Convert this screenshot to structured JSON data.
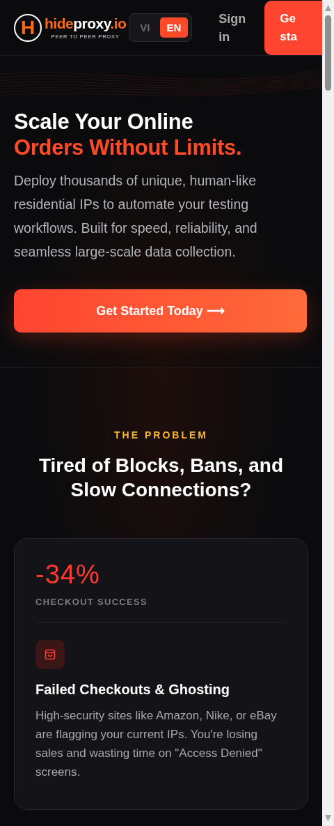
{
  "header": {
    "logo": {
      "mark": "H",
      "parts": [
        {
          "text": "hide",
          "kind": "accent"
        },
        {
          "text": "proxy",
          "kind": "plain"
        },
        {
          "text": ".io",
          "kind": "accent"
        }
      ],
      "tagline": "PEER TO PEER PROXY"
    },
    "languages": [
      {
        "label": "VI",
        "selected": false
      },
      {
        "label": "EN",
        "selected": true
      }
    ],
    "sign_in": "Sign in",
    "cta_lines": [
      "Ge",
      "sta"
    ]
  },
  "hero": {
    "title_lines": [
      {
        "text": "Scale Your Online",
        "kind": "plain"
      },
      {
        "text": "Orders Without Limits.",
        "kind": "accent"
      }
    ],
    "description": "Deploy thousands of unique, human-like residential IPs to automate your testing workflows. Built for speed, reliability, and seamless large-scale data collection.",
    "button": "Get Started Today ⟶"
  },
  "problem": {
    "eyebrow": "THE PROBLEM",
    "heading": "Tired of Blocks, Bans, and Slow Connections?",
    "cards": [
      {
        "stat": "-34%",
        "stat_label": "CHECKOUT SUCCESS",
        "title": "Failed Checkouts & Ghosting",
        "description": "High-security sites like Amazon, Nike, or eBay are flagging your current IPs. You're losing sales and wasting time on \"Access Denied\" screens."
      }
    ]
  }
}
